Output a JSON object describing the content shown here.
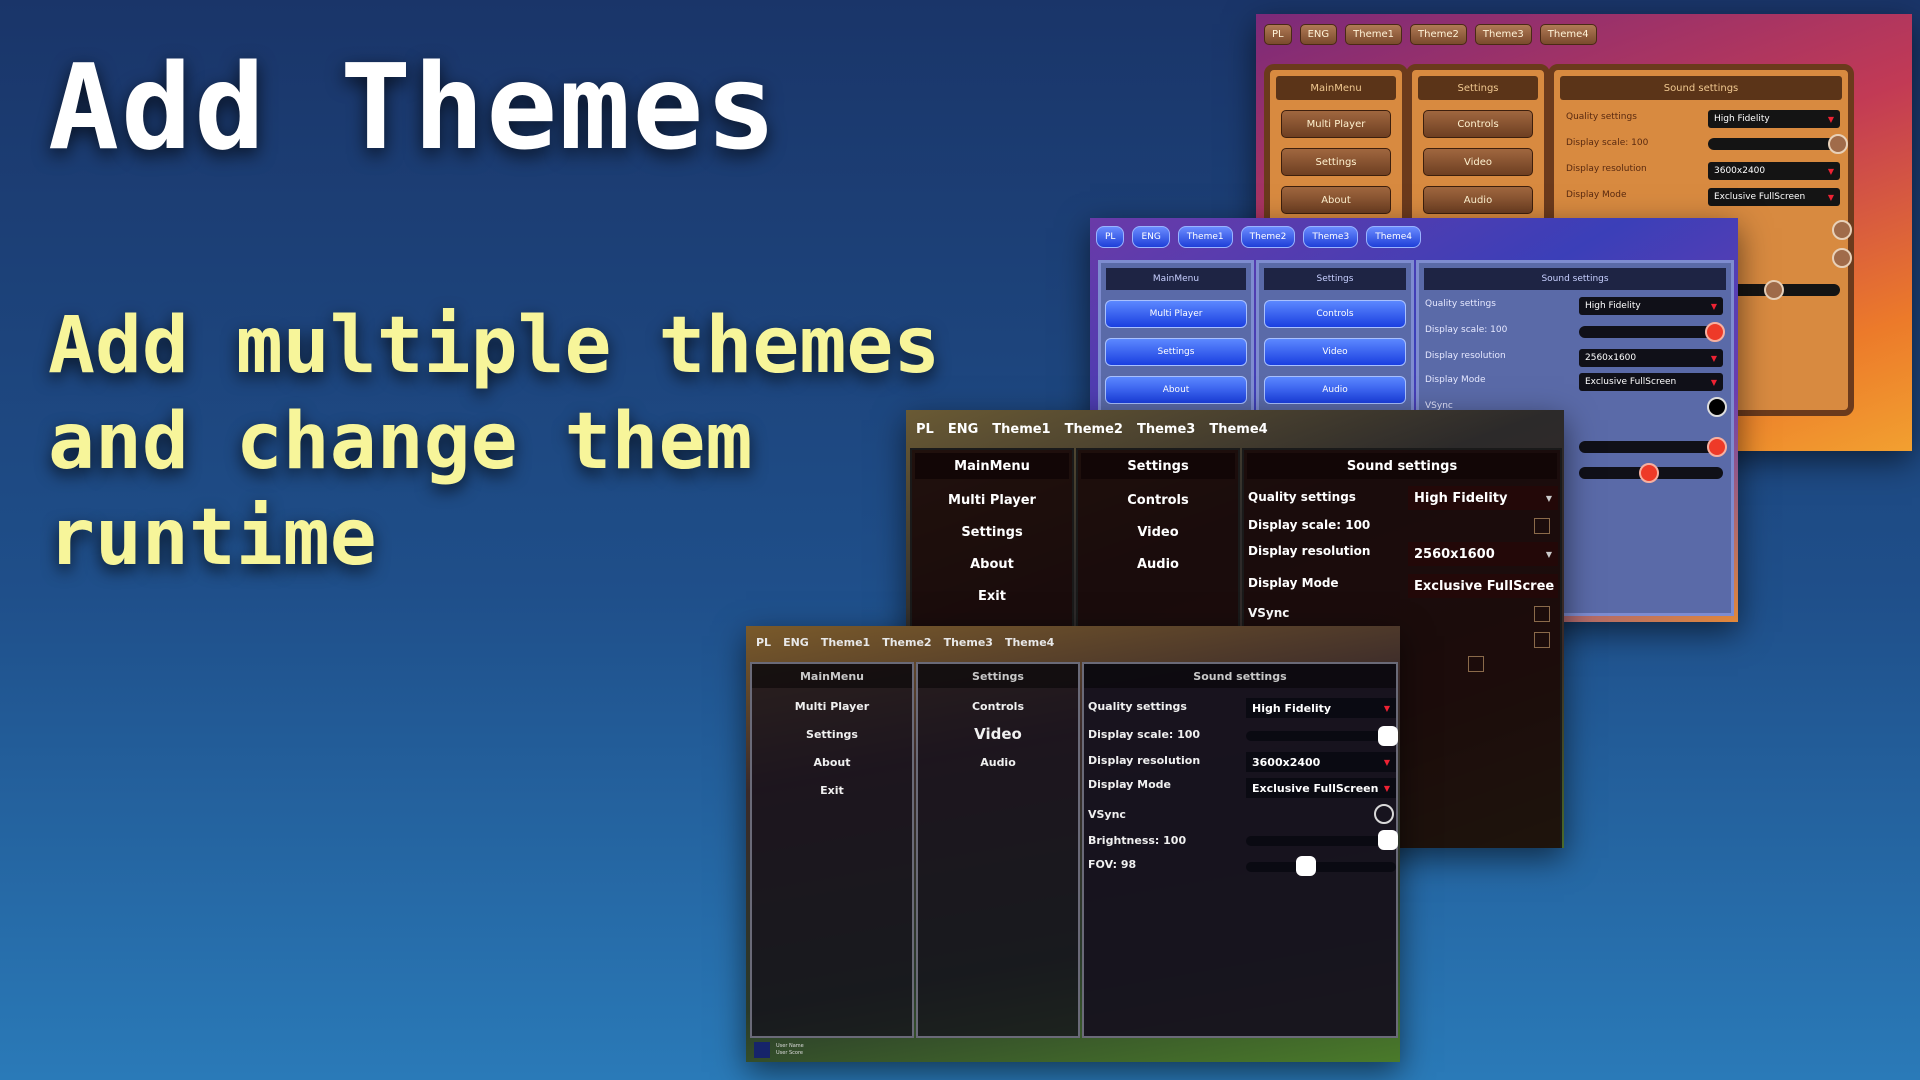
{
  "hero": {
    "title": "Add Themes",
    "subtitle": "Add multiple themes and change them runtime"
  },
  "tabs": [
    "PL",
    "ENG",
    "Theme1",
    "Theme2",
    "Theme3",
    "Theme4"
  ],
  "menu_panel": {
    "title": "MainMenu",
    "items": [
      "Multi Player",
      "Settings",
      "About",
      "Exit"
    ]
  },
  "settings_panel": {
    "title": "Settings",
    "items": [
      "Controls",
      "Video",
      "Audio"
    ]
  },
  "sound_panel": {
    "title": "Sound settings",
    "quality_label": "Quality settings",
    "quality_value": "High Fidelity",
    "scale_label": "Display scale: 100",
    "resolution_label": "Display resolution",
    "resolution_value_a": "3600x2400",
    "resolution_value_b": "2560x1600",
    "mode_label": "Display Mode",
    "mode_value": "Exclusive FullScreen",
    "mode_value_truncated": "Exclusive FullScree",
    "vsync_label": "VSync",
    "brightness_label": "Brightness: 100",
    "fov_label": "FOV: 98"
  },
  "sliders": {
    "display_scale": 1.0,
    "brightness": 1.0,
    "fov": 0.45
  },
  "user": {
    "name": "User Name",
    "score": "User Score"
  },
  "colors": {
    "title_text": "#ffffff",
    "subtitle_text": "#f7f59a",
    "theme2_accent": "#1f3fd8",
    "theme2_knob": "#ee3a28",
    "dropdown_arrow": "#e23"
  }
}
